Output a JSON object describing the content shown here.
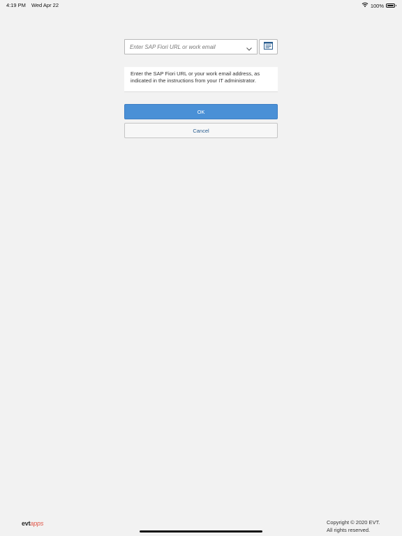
{
  "status_bar": {
    "time": "4:19 PM",
    "date": "Wed Apr 22",
    "battery_percent": "100%"
  },
  "url_field": {
    "placeholder": "Enter SAP Fiori URL or work email",
    "value": ""
  },
  "help_text": "Enter the SAP Fiori URL or your work email address, as indicated in the instructions from your IT administrator.",
  "buttons": {
    "ok_label": "OK",
    "cancel_label": "Cancel"
  },
  "footer": {
    "logo_evt": "evt",
    "logo_apps": "apps",
    "copyright_line1": "Copyright © 2020 EVT.",
    "copyright_line2": "All rights reserved."
  },
  "icons": {
    "wifi": "wifi-icon",
    "battery": "battery-icon",
    "chevron": "chevron-down-icon",
    "document": "document-icon"
  },
  "colors": {
    "background": "#f2f2f2",
    "primary_button": "#4a90d6",
    "cancel_text": "#2a5d8f",
    "logo_accent": "#e0584a"
  }
}
